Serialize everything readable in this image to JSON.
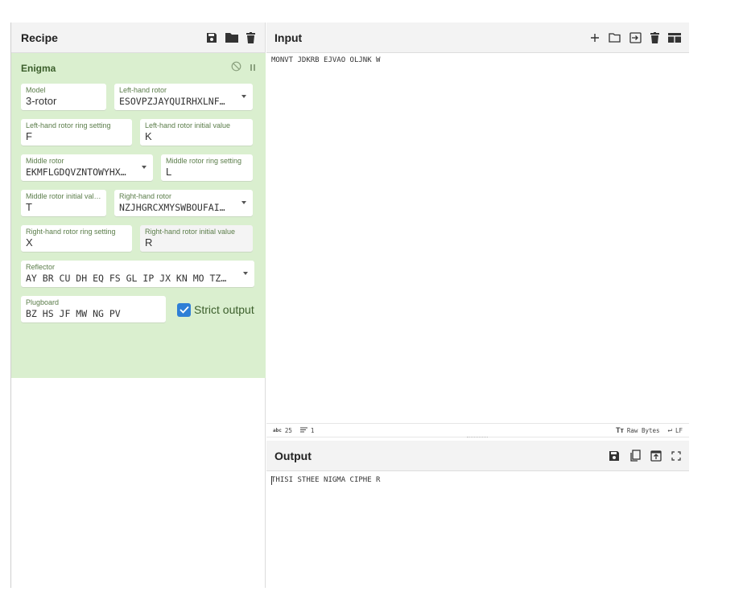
{
  "recipe": {
    "title": "Recipe",
    "icons": [
      "save-icon",
      "folder-icon",
      "trash-icon"
    ]
  },
  "operation": {
    "name": "Enigma",
    "icons": [
      "disable-icon",
      "pause-icon"
    ],
    "model": {
      "label": "Model",
      "value": "3-rotor"
    },
    "left_rotor": {
      "label": "Left-hand rotor",
      "value": "ESOVPZJAYQUIRHXLNFTGKDCMWB<K"
    },
    "left_ring": {
      "label": "Left-hand rotor ring setting",
      "value": "F"
    },
    "left_initial": {
      "label": "Left-hand rotor initial value",
      "value": "K"
    },
    "middle_rotor": {
      "label": "Middle rotor",
      "value": "EKMFLGDQVZNTOWYHXUSPAIBRCJ<R"
    },
    "middle_ring": {
      "label": "Middle rotor ring setting",
      "value": "L"
    },
    "middle_initial": {
      "label": "Middle rotor initial value",
      "value": "T"
    },
    "right_rotor": {
      "label": "Right-hand rotor",
      "value": "NZJHGRCXMYSWBOUFAIVLPEKQDT<FV"
    },
    "right_ring": {
      "label": "Right-hand rotor ring setting",
      "value": "X"
    },
    "right_initial": {
      "label": "Right-hand rotor initial value",
      "value": "R"
    },
    "reflector": {
      "label": "Reflector",
      "value": "AY BR CU DH EQ FS GL IP JX KN MO TZ VW"
    },
    "plugboard": {
      "label": "Plugboard",
      "value": "BZ HS JF MW NG PV"
    },
    "strict_output": {
      "label": "Strict output",
      "checked": true
    }
  },
  "input": {
    "title": "Input",
    "icons": [
      "plus-icon",
      "open-folder-icon",
      "import-icon",
      "trash-icon",
      "layout-icon"
    ],
    "text": "MONVT JDKRB EJVAO OLJNK W"
  },
  "status": {
    "chars": "25",
    "lines": "1",
    "encoding": "Raw Bytes",
    "eol": "LF"
  },
  "output": {
    "title": "Output",
    "icons": [
      "save-icon",
      "copy-icon",
      "replace-input-icon",
      "maximise-icon"
    ],
    "text": "THISI STHEE NIGMA CIPHE R"
  },
  "colors": {
    "op_bg": "#daefcf",
    "accent": "#2f7fd6",
    "header_bg": "#f3f3f3"
  }
}
